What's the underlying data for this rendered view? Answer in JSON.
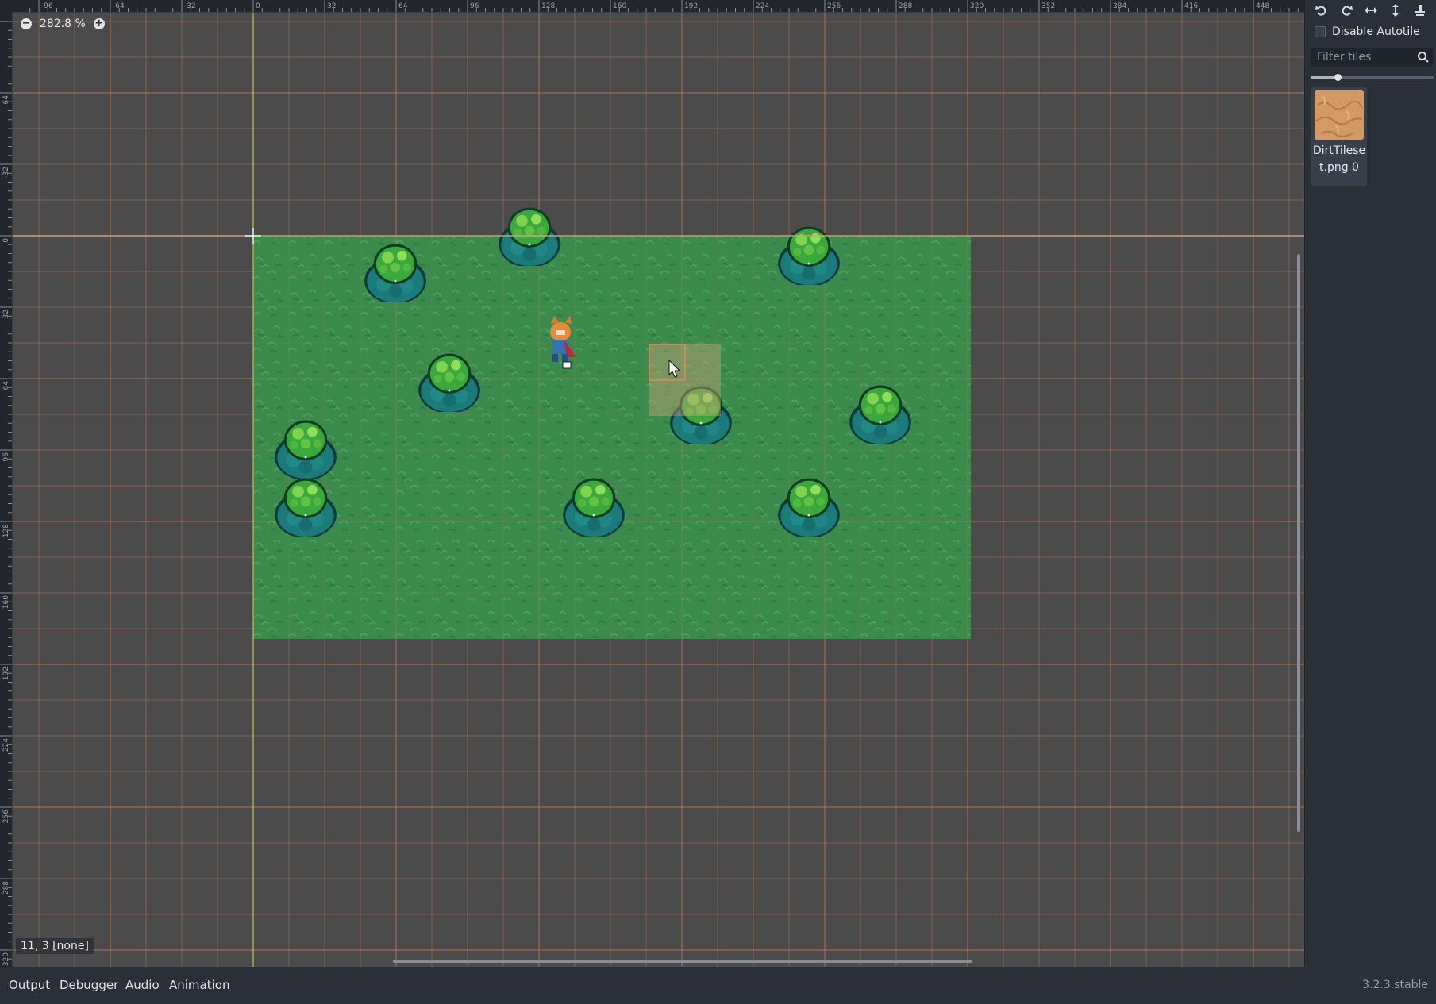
{
  "editor": {
    "zoom_label": "282.8 %",
    "coord_label": "11, 3 [none]",
    "zoom_out_icon": "minus-circle-icon",
    "zoom_in_icon": "plus-circle-icon"
  },
  "rulers": {
    "top_labels": [
      "-96",
      "-64",
      "-32",
      "0",
      "32",
      "64",
      "96",
      "128",
      "160",
      "192",
      "224",
      "256",
      "288",
      "320",
      "352",
      "384",
      "416",
      "448"
    ],
    "left_labels": [
      "-64",
      "-32",
      "0",
      "32",
      "64",
      "96",
      "128",
      "160",
      "192",
      "224",
      "256",
      "288",
      "320"
    ]
  },
  "scene": {
    "tilemap_texture": "grass",
    "tree_icon": "bush-tree-icon",
    "player_icon": "fox-player-icon",
    "cursor_icon": "mouse-pointer-icon",
    "tree_count": 10
  },
  "tile_panel": {
    "tools": [
      "rotate-left-icon",
      "rotate-right-icon",
      "flip-horizontal-icon",
      "flip-vertical-icon",
      "clear-transform-icon"
    ],
    "disable_autotile_label": "Disable Autotile",
    "disable_autotile_checked": false,
    "filter_placeholder": "Filter tiles",
    "filter_value": "",
    "tile_size_level": 0.22,
    "tiles": [
      {
        "label": "DirtTileset.png 0",
        "color": "#d49a66"
      }
    ]
  },
  "bottom_panel": {
    "tabs": [
      "Output",
      "Debugger",
      "Audio",
      "Animation"
    ],
    "version": "3.2.3.stable"
  },
  "colors": {
    "viewport_bg": "#4b4b4b",
    "grid_line": "#c47a52",
    "origin_axis_y": "#d8d24a",
    "grass": "#3a8a4c",
    "accent": "#d49a66"
  }
}
